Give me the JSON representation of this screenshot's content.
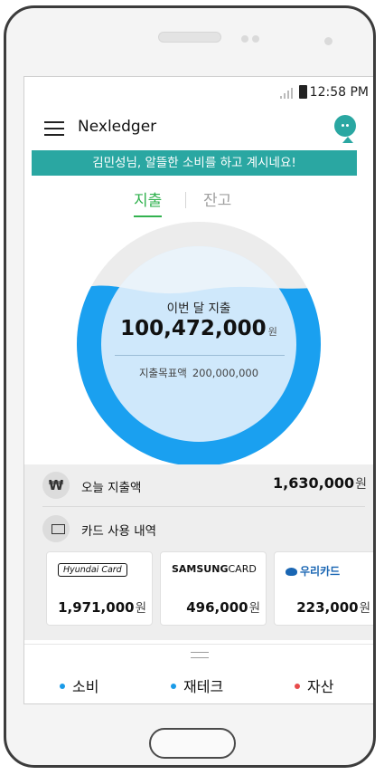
{
  "status_bar": {
    "time": "12:58 PM"
  },
  "header": {
    "title": "Nexledger"
  },
  "banner": {
    "text": "김민성님, 알뜰한 소비를 하고 계시네요!"
  },
  "tabs": [
    {
      "label": "지출",
      "active": true
    },
    {
      "label": "잔고",
      "active": false
    }
  ],
  "gauge": {
    "label": "이번 달 지출",
    "amount": "100,472,000",
    "unit": "원",
    "target_label": "지출목표액",
    "target_value": "200,000,000",
    "ring_color": "#1aa0f0",
    "fill_color": "#cfe8fb"
  },
  "today": {
    "icon": "₩",
    "label": "오늘 지출액",
    "value": "1,630,000",
    "unit": "원"
  },
  "cards_section": {
    "label": "카드 사용 내역"
  },
  "cards": [
    {
      "logo": "Hyundai Card",
      "amount": "1,971,000",
      "unit": "원"
    },
    {
      "logo_bold": "SAMSUNG",
      "logo_rest": "CARD",
      "amount": "496,000",
      "unit": "원"
    },
    {
      "logo": "우리카드",
      "amount": "223,000",
      "unit": "원"
    }
  ],
  "bottom_nav": [
    {
      "label": "소비",
      "dot_color": "#1a9be8"
    },
    {
      "label": "재테크",
      "dot_color": "#1a9be8"
    },
    {
      "label": "자산",
      "dot_color": "#e84b4b"
    }
  ],
  "colors": {
    "accent": "#2aa7a2",
    "active_tab": "#32b24f"
  }
}
